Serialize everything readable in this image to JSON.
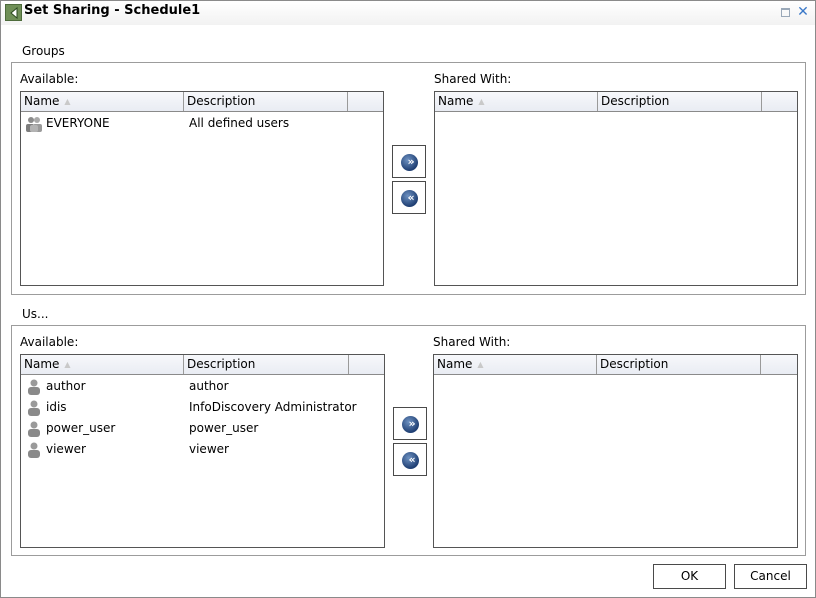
{
  "window": {
    "title": "Set Sharing - Schedule1",
    "icon": "back-arrow-icon",
    "close_glyph": "✕"
  },
  "groups": {
    "legend": "Groups",
    "available_label": "Available:",
    "shared_label": "Shared With:",
    "columns": {
      "name": "Name",
      "description": "Description"
    },
    "available_rows": [
      {
        "name": "EVERYONE",
        "description": "All defined users",
        "icon": "group-icon"
      }
    ],
    "shared_rows": [],
    "add_button": {
      "glyph": "»",
      "icon": "move-right-icon"
    },
    "remove_button": {
      "glyph": "«",
      "icon": "move-left-icon"
    }
  },
  "users": {
    "legend": "Us...",
    "available_label": "Available:",
    "shared_label": "Shared With:",
    "columns": {
      "name": "Name",
      "description": "Description"
    },
    "available_rows": [
      {
        "name": "author",
        "description": "author",
        "icon": "user-icon"
      },
      {
        "name": "idis",
        "description": "InfoDiscovery Administrator",
        "icon": "user-icon"
      },
      {
        "name": "power_user",
        "description": "power_user",
        "icon": "user-icon"
      },
      {
        "name": "viewer",
        "description": "viewer",
        "icon": "user-icon"
      }
    ],
    "shared_rows": [],
    "add_button": {
      "glyph": "»",
      "icon": "move-right-icon"
    },
    "remove_button": {
      "glyph": "«",
      "icon": "move-left-icon"
    }
  },
  "footer": {
    "ok_label": "OK",
    "cancel_label": "Cancel"
  },
  "colors": {
    "arrow_button_fill": "#1f3f73",
    "close_icon": "#3a78c8",
    "header_bg": "#e9ecf3"
  }
}
